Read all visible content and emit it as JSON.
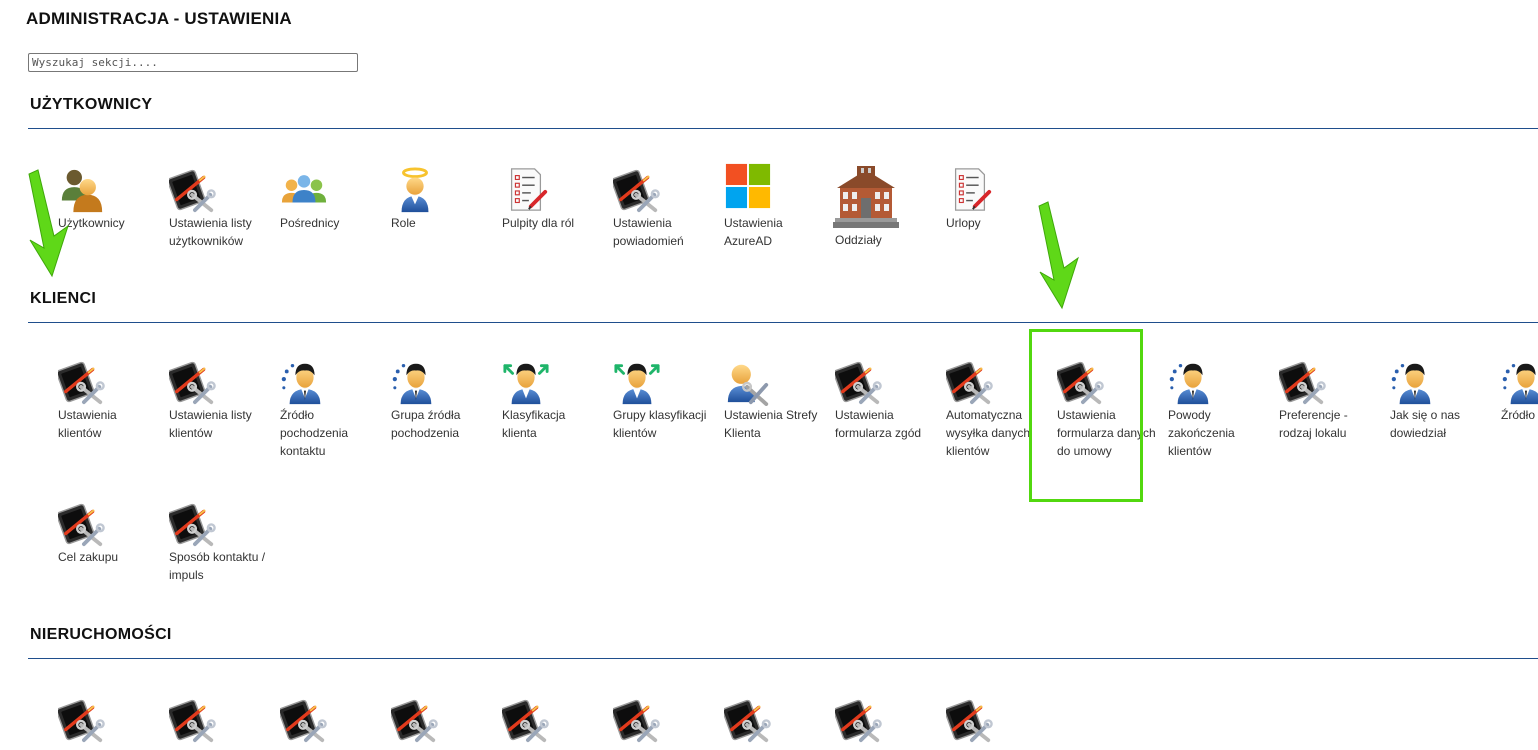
{
  "header": {
    "title": "ADMINISTRACJA - USTAWIENIA"
  },
  "search": {
    "placeholder": "Wyszukaj sekcji...."
  },
  "sections": [
    {
      "title": "UŻYTKOWNICY",
      "items": [
        {
          "label": "Użytkownicy",
          "icon": "users-icon"
        },
        {
          "label": "Ustawienia listy użytkowników",
          "icon": "settings-tools-icon"
        },
        {
          "label": "Pośrednicy",
          "icon": "agents-group-icon"
        },
        {
          "label": "Role",
          "icon": "angel-user-icon"
        },
        {
          "label": "Pulpity dla ról",
          "icon": "checklist-icon"
        },
        {
          "label": "Ustawienia powiadomień",
          "icon": "settings-tools-icon"
        },
        {
          "label": "Ustawienia AzureAD",
          "icon": "microsoft-logo-icon"
        },
        {
          "label": "Oddziały",
          "icon": "building-icon"
        },
        {
          "label": "Urlopy",
          "icon": "checklist-icon"
        }
      ]
    },
    {
      "title": "KLIENCI",
      "items": [
        {
          "label": "Ustawienia klientów",
          "icon": "settings-tools-icon"
        },
        {
          "label": "Ustawienia listy klientów",
          "icon": "settings-tools-icon"
        },
        {
          "label": "Źródło pochodzenia kontaktu",
          "icon": "client-dots-icon"
        },
        {
          "label": "Grupa źródła pochodzenia",
          "icon": "client-dots-icon"
        },
        {
          "label": "Klasyfikacja klienta",
          "icon": "client-arrows-icon"
        },
        {
          "label": "Grupy klasyfikacji klientów",
          "icon": "client-arrows-icon"
        },
        {
          "label": "Ustawienia Strefy Klienta",
          "icon": "user-tools-icon"
        },
        {
          "label": "Ustawienia formularza zgód",
          "icon": "settings-tools-icon"
        },
        {
          "label": "Automatyczna wysyłka danych klientów",
          "icon": "settings-tools-icon"
        },
        {
          "label": "Ustawienia formularza danych do umowy",
          "icon": "settings-tools-icon"
        },
        {
          "label": "Powody zakończenia klientów",
          "icon": "client-dots-icon"
        },
        {
          "label": "Preferencje - rodzaj lokalu",
          "icon": "settings-tools-icon"
        },
        {
          "label": "Jak się o nas dowiedział",
          "icon": "client-dots-icon"
        },
        {
          "label": "Źródło finanso",
          "icon": "client-dots-icon"
        },
        {
          "label": "Cel zakupu",
          "icon": "settings-tools-icon"
        },
        {
          "label": "Sposób kontaktu / impuls",
          "icon": "settings-tools-icon"
        }
      ]
    },
    {
      "title": "NIERUCHOMOŚCI",
      "items": [
        {
          "label": "",
          "icon": "settings-tools-icon"
        },
        {
          "label": "",
          "icon": "settings-tools-icon"
        },
        {
          "label": "",
          "icon": "settings-tools-icon"
        },
        {
          "label": "",
          "icon": "settings-tools-icon"
        },
        {
          "label": "",
          "icon": "settings-tools-icon"
        },
        {
          "label": "",
          "icon": "settings-tools-icon"
        },
        {
          "label": "",
          "icon": "settings-tools-icon"
        },
        {
          "label": "",
          "icon": "settings-tools-icon"
        },
        {
          "label": "",
          "icon": "settings-tools-icon"
        }
      ]
    }
  ],
  "colors": {
    "section_rule": "#1f4e8c",
    "highlight": "#52d80f",
    "arrow": "#5fd818"
  }
}
